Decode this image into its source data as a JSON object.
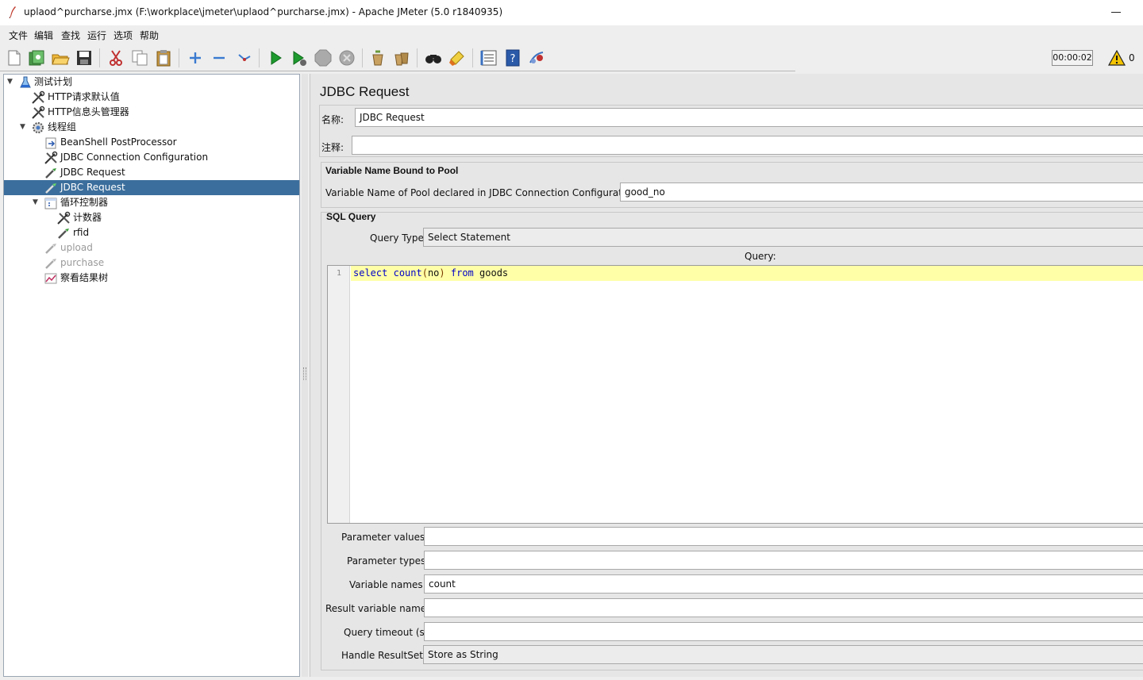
{
  "window": {
    "title": "uplaod^purcharse.jmx (F:\\workplace\\jmeter\\uplaod^purcharse.jmx) - Apache JMeter (5.0 r1840935)"
  },
  "menu": [
    "文件",
    "编辑",
    "查找",
    "运行",
    "选项",
    "帮助"
  ],
  "toolbar": {
    "timer": "00:00:02",
    "warning_count": "0",
    "buttons": [
      "new-icon",
      "templates-icon",
      "open-icon",
      "save-icon",
      "cut-icon",
      "copy-icon",
      "paste-icon",
      "expand-icon",
      "collapse-icon",
      "toggle-icon",
      "start-icon",
      "start-no-pause-icon",
      "stop-icon",
      "shutdown-icon",
      "clear-icon",
      "clear-all-icon",
      "search-icon",
      "reset-search-icon",
      "function-helper-icon",
      "help-icon",
      "remote-icon"
    ]
  },
  "tree": [
    {
      "label": "测试计划",
      "type": "test-plan",
      "expanded": true
    },
    {
      "label": "HTTP请求默认值",
      "type": "config"
    },
    {
      "label": "HTTP信息头管理器",
      "type": "config"
    },
    {
      "label": "线程组",
      "type": "thread-group",
      "expanded": true
    },
    {
      "label": "BeanShell PostProcessor",
      "type": "postprocessor"
    },
    {
      "label": "JDBC Connection Configuration",
      "type": "config"
    },
    {
      "label": "JDBC Request",
      "type": "sampler"
    },
    {
      "label": "JDBC Request",
      "type": "sampler",
      "selected": true
    },
    {
      "label": "循环控制器",
      "type": "controller",
      "expanded": true
    },
    {
      "label": "计数器",
      "type": "config"
    },
    {
      "label": "rfid",
      "type": "sampler"
    },
    {
      "label": "upload",
      "type": "sampler",
      "disabled": true
    },
    {
      "label": "purchase",
      "type": "sampler",
      "disabled": true
    },
    {
      "label": "察看结果树",
      "type": "listener"
    }
  ],
  "panel": {
    "title": "JDBC Request",
    "name_label": "名称:",
    "name_value": "JDBC Request",
    "comment_label": "注释:",
    "comment_value": "",
    "pool_section": "Variable Name Bound to Pool",
    "pool_label": "Variable Name of Pool declared in JDBC Connection Configuration:",
    "pool_value": "good_no",
    "sql_section": "SQL Query",
    "query_type_label": "Query Type:",
    "query_type_value": "Select Statement",
    "query_label": "Query:",
    "query_line_number": "1",
    "query_tokens": [
      {
        "text": "select",
        "kind": "kw"
      },
      {
        "text": " ",
        "kind": "plain"
      },
      {
        "text": "count",
        "kind": "kw"
      },
      {
        "text": "(",
        "kind": "paren"
      },
      {
        "text": "no",
        "kind": "plain"
      },
      {
        "text": ")",
        "kind": "paren"
      },
      {
        "text": " ",
        "kind": "plain"
      },
      {
        "text": "from",
        "kind": "kw"
      },
      {
        "text": " ",
        "kind": "plain"
      },
      {
        "text": "goods",
        "kind": "plain"
      }
    ],
    "parameter_values_label": "Parameter values:",
    "parameter_values": "",
    "parameter_types_label": "Parameter types:",
    "parameter_types": "",
    "variable_names_label": "Variable names:",
    "variable_names": "count",
    "result_variable_label": "Result variable name:",
    "result_variable": "",
    "query_timeout_label": "Query timeout (s):",
    "query_timeout": "",
    "handle_resultset_label": "Handle ResultSet:",
    "handle_resultset_value": "Store as String"
  },
  "colors": {
    "selection": "#3b6e9c",
    "sql_keyword": "#0000c8",
    "current_line": "#ffffa8"
  }
}
